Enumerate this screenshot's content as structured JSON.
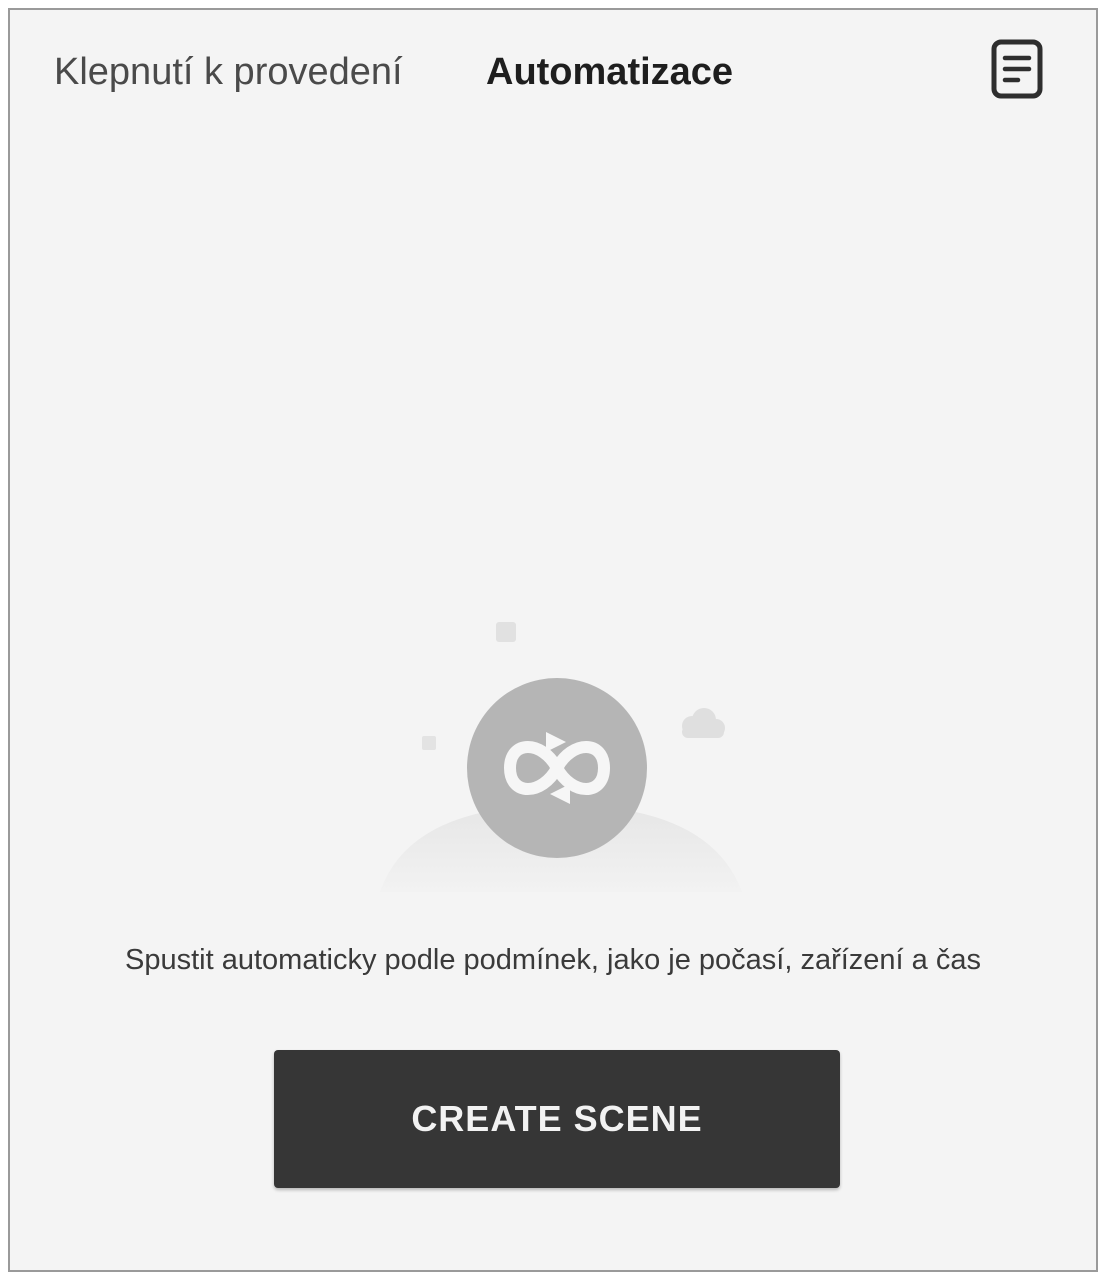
{
  "tabs": [
    {
      "label": "Klepnutí k provedení",
      "active": false
    },
    {
      "label": "Automatizace",
      "active": true
    }
  ],
  "header": {
    "log_icon": "document-list-icon"
  },
  "empty_state": {
    "illustration_icon": "automation-loop-icon",
    "description": "Spustit automaticky podle podmínek, jako je počasí, zařízení a čas"
  },
  "actions": {
    "create_scene_label": "CREATE SCENE"
  },
  "colors": {
    "background": "#f4f4f4",
    "button": "#363636",
    "active_tab_text": "#1e1e1e",
    "inactive_tab_text": "#4a4a4a"
  }
}
